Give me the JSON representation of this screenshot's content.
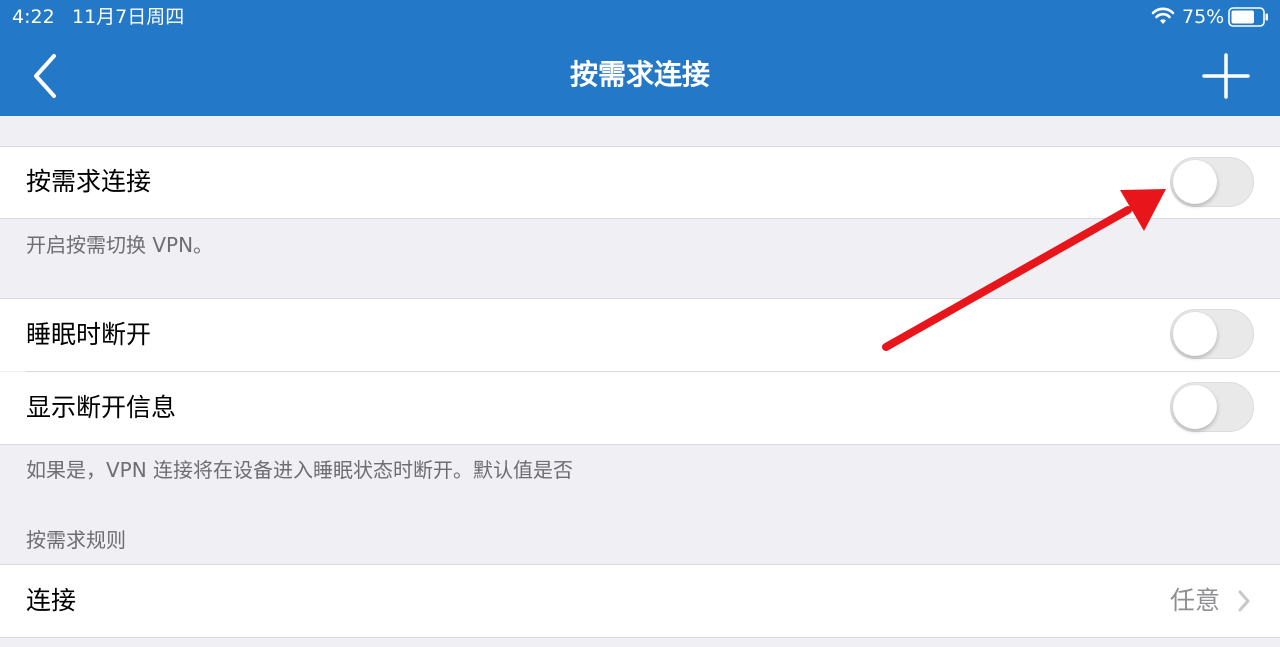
{
  "status_bar": {
    "time": "4:22",
    "date": "11月7日周四",
    "battery_percent": "75%",
    "battery_level": 0.75
  },
  "nav": {
    "title": "按需求连接",
    "back_icon": "chevron-left-icon",
    "add_icon": "plus-icon"
  },
  "settings": {
    "on_demand": {
      "label": "按需求连接",
      "enabled": false
    },
    "on_demand_footer": "开启按需切换 VPN。",
    "disconnect_on_sleep": {
      "label": "睡眠时断开",
      "enabled": false
    },
    "show_disconnect_info": {
      "label": "显示断开信息",
      "enabled": false
    },
    "sleep_footer": "如果是，VPN 连接将在设备进入睡眠状态时断开。默认值是否",
    "rules_header": "按需求规则",
    "connect": {
      "label": "连接",
      "value": "任意"
    }
  },
  "colors": {
    "header_bg": "#2478c8",
    "page_bg": "#efeff4",
    "annotation_arrow": "#e8161b"
  }
}
